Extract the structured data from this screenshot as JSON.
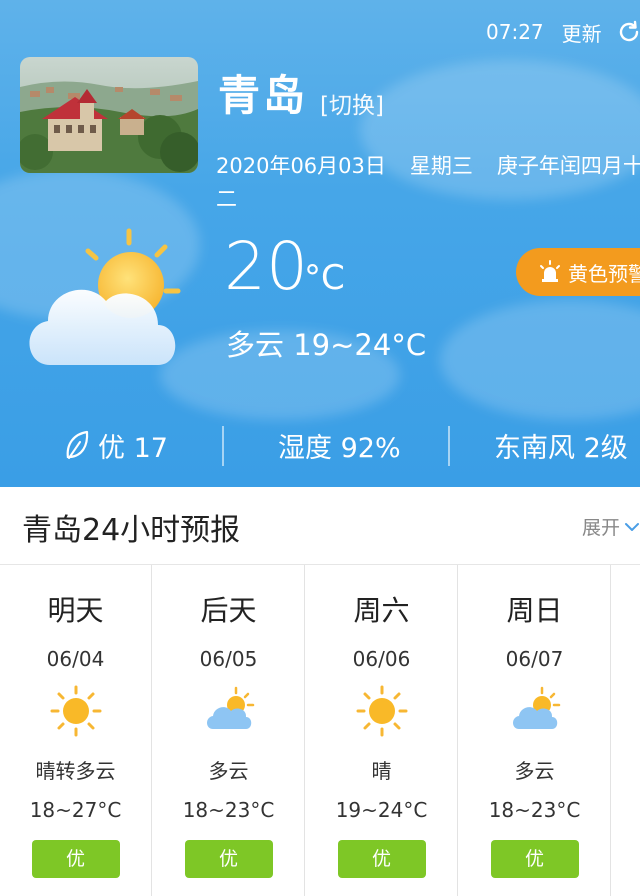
{
  "header": {
    "time": "07:27",
    "refresh_label": "更新"
  },
  "city": {
    "name": "青岛",
    "switch_label": "[切换]"
  },
  "date": {
    "gregorian": "2020年06月03日",
    "weekday": "星期三",
    "lunar_line1": "庚子年闰四月十",
    "lunar_line2": "二"
  },
  "current": {
    "temperature": "20",
    "unit": "°C",
    "condition_range": "多云 19~24°C",
    "icon": "partly-cloudy-icon",
    "alert_label": "黄色预警"
  },
  "stats": {
    "aqi": "优 17",
    "humidity": "湿度 92%",
    "wind": "东南风 2级"
  },
  "forecast": {
    "title": "青岛24小时预报",
    "expand_label": "展开",
    "days": [
      {
        "name": "明天",
        "date": "06/04",
        "icon": "sun-icon",
        "condition": "晴转多云",
        "range": "18~27°C",
        "aqi": "优"
      },
      {
        "name": "后天",
        "date": "06/05",
        "icon": "cloud-sun-icon",
        "condition": "多云",
        "range": "18~23°C",
        "aqi": "优"
      },
      {
        "name": "周六",
        "date": "06/06",
        "icon": "sun-icon",
        "condition": "晴",
        "range": "19~24°C",
        "aqi": "优"
      },
      {
        "name": "周日",
        "date": "06/07",
        "icon": "cloud-sun-icon",
        "condition": "多云",
        "range": "18~23°C",
        "aqi": "优"
      }
    ]
  },
  "colors": {
    "sky": "#46a6e8",
    "alert": "#f39b1e",
    "aqi_good": "#7ec726"
  }
}
